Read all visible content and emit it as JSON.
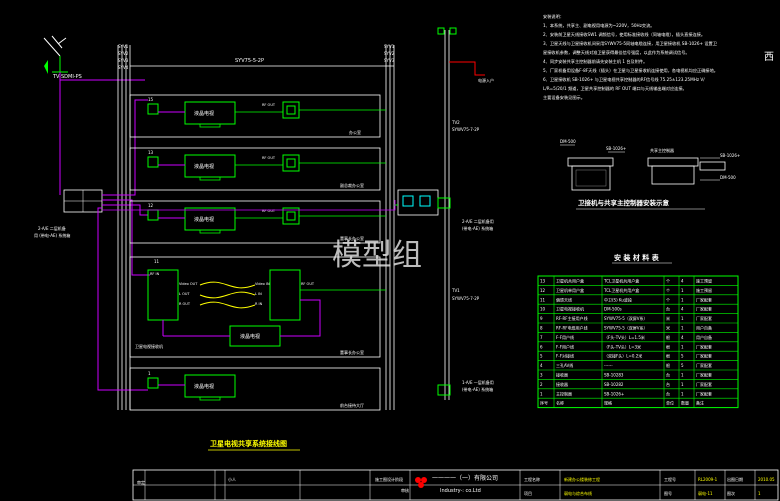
{
  "diagram": {
    "left_antenna_label": "TV-SDMI-PS",
    "trunk_cable": "SYV75-5-2P",
    "trunk_bus_labels": [
      "SYV1",
      "SYV2",
      "SYV3",
      "SYV4"
    ],
    "right_bus_labels": [
      "SYV1",
      "SYV2",
      "SYV3"
    ],
    "power_label": "电源入户",
    "cable_tv2": "SYWV75-7-2P",
    "cable_tv1": "SYWV75-7-2P",
    "switch_box_label": "2-A/E 二层机备\n用 (带电-AE) 系统箱",
    "right_top_box": "2-A/E 二层机备用\n(带电-AE) 系统箱",
    "right_bottom_box": "1-A/E 一层机备用\n(带电-AE) 系统箱",
    "left_side_note": "2-A/E 二层机备\n用 (带电-AE) 系统箱",
    "watermark": "模型组",
    "corner_fragment": "西",
    "floors": [
      {
        "num": "15",
        "tv": "液晶电视",
        "room": "办公室",
        "splitter": "RF OUT"
      },
      {
        "num": "13",
        "tv": "液晶电视",
        "room": "副总裁办公室",
        "splitter": "RF OUT"
      },
      {
        "num": "12",
        "tv": "液晶电视",
        "room": "董事长办公室",
        "splitter": "RF OUT"
      },
      {
        "num": "11",
        "tv": "液晶电视",
        "room": "董事长办公室",
        "splitter": "RF OUT"
      },
      {
        "num": "1",
        "tv": "液晶电视",
        "room": "前台接待大厅",
        "splitter": "RF OUT"
      }
    ],
    "receiver_labels": {
      "rf_in": "RF IN",
      "video_out": "Video OUT",
      "l_out": "L OUT",
      "r_out": "R OUT",
      "rf_out": "RF OUT",
      "video_in": "Video IN",
      "l_in": "L IN",
      "r_in": "R IN"
    },
    "floor4_room_label": "卫星电视接收机"
  },
  "diagram_title": "卫星电视共享系统接线图",
  "notes": {
    "title": "安装说明：",
    "lines": [
      "1、本系统，共享主、副电视用电源为~220V，50Hz交流。",
      "2、安装前卫星天线接收SW1 调频信号，使用标准接收线（同轴电缆），插头直接连接。",
      "3、卫星天线与卫星接收机间采用SYWV75-5同轴电缆连接，用卫星接收机 SB-1026+ 设置卫",
      "   星接收机参数，调整天线对准卫星获得最佳信号强度，以此作为系统调试信号。",
      "4、同步安装共享主控制器前请先安装主机 1 台及附件。",
      "5、厂家机备用设备F-8F天线（插头）在卫星与卫星接收机连接使用，各电视机均应正确接地。",
      "6、卫星接收机 SB-1026+ 与卫星电视共享控制器的RF信号线 75.25±123.25MHz V/",
      "   L/R=5/20/1 频道，卫星共享控制器的 RF OUT 端口与天线输出端对应连接。",
      "   主要设备安装见图示。"
    ]
  },
  "install_diagram": {
    "title": "卫接机与共享主控制器安装示意",
    "left_label_top": "DM-500",
    "left_label_mid": "SB-1026+",
    "left_label_bot": "卫星接收机",
    "right_label_top": "共享主控制器",
    "right_label_mid": "SB-1026+",
    "right_label_bot": "DM-500"
  },
  "materials": {
    "title": "安 装 材 料 表",
    "headers": [
      "序号",
      "名称",
      "规格/型号",
      "单位",
      "数量",
      "备注"
    ],
    "rows": [
      [
        "13",
        "卫星机共用户盒",
        "TCL卫星机共用户盒",
        "个",
        "4",
        "施工预留"
      ],
      [
        "12",
        "卫星机单用户盒",
        "TCL卫星机共用户盒",
        "个",
        "1",
        "施工预留"
      ],
      [
        "11",
        "偏馈天线",
        "中卫(S) Ku波段",
        "个",
        "1",
        "厂家配套"
      ],
      [
        "10",
        "卫星电视接收机",
        "DM-500s",
        "台",
        "4",
        "厂家配套"
      ],
      [
        "9",
        "RF-RF主接用户线",
        "SYWV75-5（双屏V系）",
        "米",
        "1",
        "厂家配套"
      ],
      [
        "8",
        "RF-RF电缆用户线",
        "SYWV75-5（双屏V系）",
        "米",
        "1",
        "用户自备"
      ],
      [
        "7",
        "F-F用户线",
        "（F头-TV头）L=1.5米",
        "根",
        "4",
        "用户自备"
      ],
      [
        "6",
        "F-F用户线",
        "（F头-TV头）L=3米",
        "根",
        "1",
        "厂家配套"
      ],
      [
        "5",
        "F-F对接线",
        "（双接F头）L=0.2米",
        "根",
        "5",
        "厂家配套"
      ],
      [
        "4",
        "三孔AV线",
        "------",
        "根",
        "5",
        "厂家配套"
      ],
      [
        "3",
        "接收器",
        "SB-10283",
        "台",
        "1",
        "厂家配套"
      ],
      [
        "2",
        "接收器",
        "SB-10282",
        "台",
        "1",
        "厂家配套"
      ],
      [
        "1",
        "主控制器",
        "SB-1026+",
        "台",
        "1",
        "厂家配套"
      ]
    ],
    "footer": [
      "序号",
      "名称",
      "规格",
      "单位",
      "数量",
      "备注"
    ]
  },
  "title_block": {
    "left_col1": "审定",
    "left_col2": "小人",
    "construction_note": "施工图设计阶段",
    "side_label": "审核",
    "company": "一一一一（一）有限公司",
    "company_en": "Industry-: co.Ltd",
    "project_label": "工程名称",
    "project": "新建办公楼装修工程",
    "drawing_label": "项目",
    "drawing": "弱电与综合布线",
    "no_label": "工程号",
    "no": "RL2009-1",
    "sub_label": "图号",
    "sub": "弱电-11",
    "date_label": "出图日期",
    "date": "2010.05",
    "scale_label": "图次",
    "scale": "1"
  }
}
